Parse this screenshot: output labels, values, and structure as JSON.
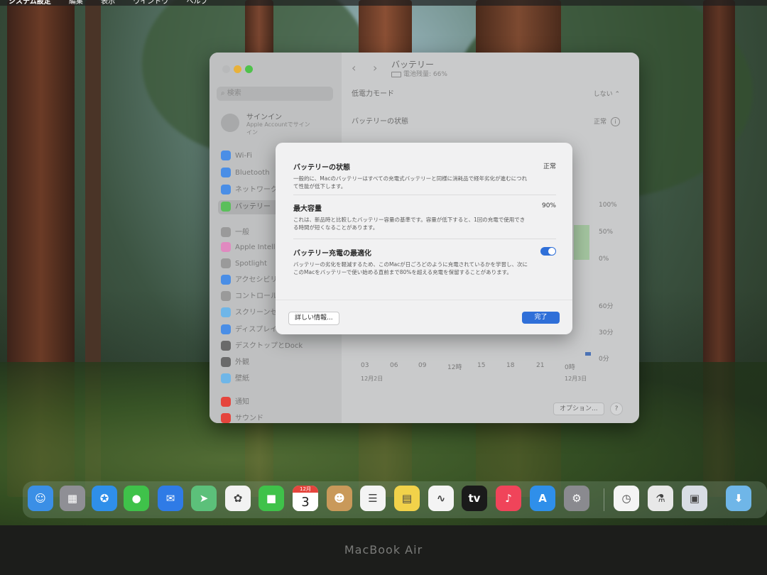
{
  "menubar": {
    "app": "システム設定",
    "items": [
      "編集",
      "表示",
      "ウインドウ",
      "ヘルプ"
    ]
  },
  "window": {
    "search_placeholder": "検索",
    "signin_title": "サインイン",
    "signin_sub": "Apple Accountでサインイン",
    "sidebar": [
      {
        "label": "Wi-Fi",
        "icon": "wifi-icon",
        "color": "#4a8ee6"
      },
      {
        "label": "Bluetooth",
        "icon": "bluetooth-icon",
        "color": "#4a8ee6"
      },
      {
        "label": "ネットワーク",
        "icon": "network-icon",
        "color": "#4a8ee6"
      },
      {
        "label": "バッテリー",
        "icon": "battery-icon",
        "color": "#5bbf5b"
      },
      {
        "label": "一般",
        "icon": "gear-icon",
        "color": "#9a9a9a"
      },
      {
        "label": "Apple Intelligence",
        "icon": "apple-intelligence-icon",
        "color": "#e08ac0"
      },
      {
        "label": "Spotlight",
        "icon": "spotlight-icon",
        "color": "#9a9a9a"
      },
      {
        "label": "アクセシビリティ",
        "icon": "accessibility-icon",
        "color": "#4a8ee6"
      },
      {
        "label": "コントロールセンター",
        "icon": "control-center-icon",
        "color": "#9a9a9a"
      },
      {
        "label": "スクリーンセーバ",
        "icon": "screensaver-icon",
        "color": "#6fb6e8"
      },
      {
        "label": "ディスプレイ",
        "icon": "display-icon",
        "color": "#4a8ee6"
      },
      {
        "label": "デスクトップとDock",
        "icon": "dock-icon",
        "color": "#6a6a6a"
      },
      {
        "label": "外観",
        "icon": "appearance-icon",
        "color": "#6a6a6a"
      },
      {
        "label": "壁紙",
        "icon": "wallpaper-icon",
        "color": "#6fb6e8"
      },
      {
        "label": "通知",
        "icon": "notification-icon",
        "color": "#e5453d"
      },
      {
        "label": "サウンド",
        "icon": "sound-icon",
        "color": "#e5453d"
      }
    ],
    "pane_title": "バッテリー",
    "pane_sub": "電池残量: 66%",
    "low_power_label": "低電力モード",
    "low_power_value": "しない",
    "battery_health_label": "バッテリーの状態",
    "battery_health_value": "正常",
    "chart_y_top": [
      "100%",
      "50%",
      "0%"
    ],
    "chart_y_bottom": [
      "60分",
      "30分",
      "0分"
    ],
    "chart_x": [
      "03",
      "06",
      "09",
      "12時",
      "15",
      "18",
      "21",
      "0時"
    ],
    "date_left": "12月2日",
    "date_right": "12月3日",
    "options_button": "オプション...",
    "help_button": "?"
  },
  "sheet": {
    "health_title": "バッテリーの状態",
    "health_value": "正常",
    "health_desc": "一般的に、Macのバッテリーはすべての充電式バッテリーと同様に消耗品で経年劣化が進むにつれて性能が低下します。",
    "capacity_title": "最大容量",
    "capacity_value": "90%",
    "capacity_desc": "これは、新品時と比較したバッテリー容量の基準です。容量が低下すると、1回の充電で使用できる時間が短くなることがあります。",
    "optimize_title": "バッテリー充電の最適化",
    "optimize_desc": "バッテリーの劣化を軽減するため、このMacが日ごろどのように充電されているかを学習し、次にこのMacをバッテリーで使い始める直前まで80%を超える充電を保留することがあります。",
    "optimize_on": true,
    "more_info": "詳しい情報...",
    "done": "完了"
  },
  "dock": [
    {
      "name": "finder",
      "glyph": "☺",
      "color": "#3b8fe6"
    },
    {
      "name": "launchpad",
      "glyph": "▦",
      "color": "#8f8f95"
    },
    {
      "name": "safari",
      "glyph": "✪",
      "color": "#2f8fea"
    },
    {
      "name": "messages",
      "glyph": "●",
      "color": "#3fc24a"
    },
    {
      "name": "mail",
      "glyph": "✉",
      "color": "#2f7be6"
    },
    {
      "name": "maps",
      "glyph": "➤",
      "color": "#5cc07a"
    },
    {
      "name": "photos",
      "glyph": "✿",
      "color": "#f2f2f2"
    },
    {
      "name": "facetime",
      "glyph": "■",
      "color": "#3fc24a"
    },
    {
      "name": "calendar",
      "month": "12月",
      "day": "3"
    },
    {
      "name": "contacts",
      "glyph": "☻",
      "color": "#c9995a"
    },
    {
      "name": "reminders",
      "glyph": "☰",
      "color": "#f4f4f4"
    },
    {
      "name": "notes",
      "glyph": "▤",
      "color": "#f2d24a"
    },
    {
      "name": "freeform",
      "glyph": "∿",
      "color": "#f4f4f4"
    },
    {
      "name": "apple-tv",
      "glyph": "tv",
      "color": "#1a1a1a"
    },
    {
      "name": "music",
      "glyph": "♪",
      "color": "#f0445a"
    },
    {
      "name": "app-store",
      "glyph": "A",
      "color": "#2f8fea"
    },
    {
      "name": "system-settings",
      "glyph": "⚙",
      "color": "#8a8a8f"
    },
    {
      "name": "clock",
      "glyph": "◷",
      "color": "#f4f4f4"
    },
    {
      "name": "automator",
      "glyph": "⚗",
      "color": "#e8e8e8"
    },
    {
      "name": "preview",
      "glyph": "▣",
      "color": "#d8dde4"
    },
    {
      "name": "downloads-folder",
      "glyph": "⬇",
      "color": "#6fb6e8"
    }
  ],
  "bezel_label": "MacBook Air"
}
